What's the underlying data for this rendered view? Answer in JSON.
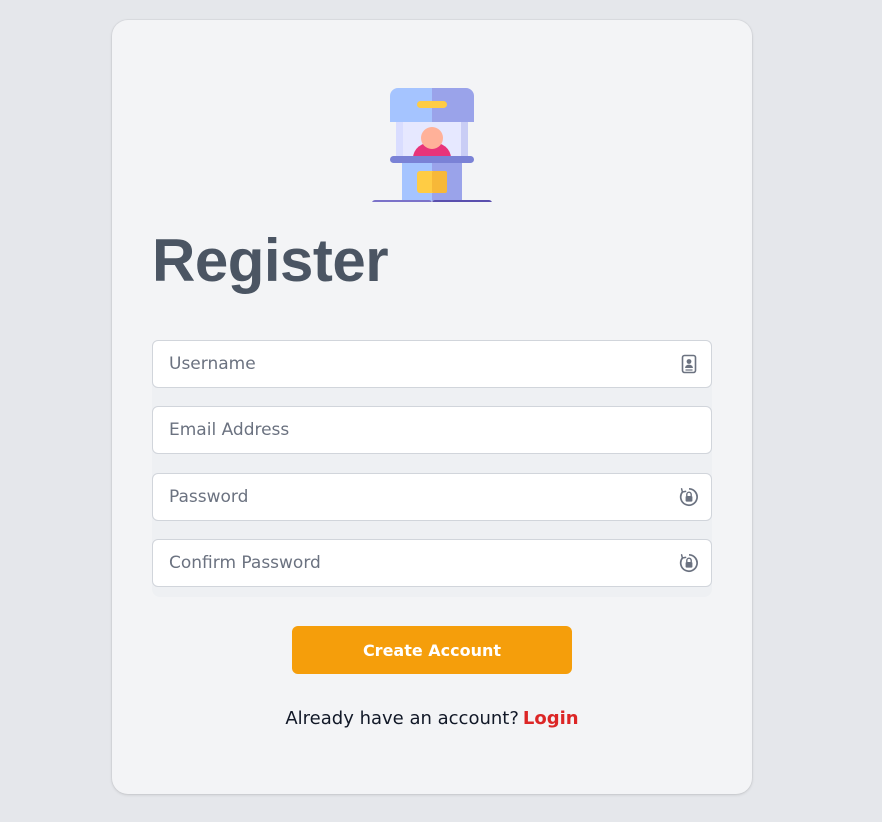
{
  "page": {
    "title": "Register"
  },
  "logo": {
    "icon": "ticket-booth-icon"
  },
  "form": {
    "username": {
      "placeholder": "Username",
      "value": "",
      "icon": "id-card-icon"
    },
    "email": {
      "placeholder": "Email Address",
      "value": ""
    },
    "password": {
      "placeholder": "Password",
      "value": "",
      "icon": "lock-icon"
    },
    "confirm_password": {
      "placeholder": "Confirm Password",
      "value": "",
      "icon": "lock-icon"
    },
    "submit_label": "Create Account"
  },
  "footer": {
    "prompt": "Already have an account?",
    "login_label": "Login"
  },
  "colors": {
    "page_bg": "#e5e7eb",
    "card_bg": "#f3f4f6",
    "title": "#4b5563",
    "button": "#f59e0b",
    "link": "#dc2626"
  }
}
